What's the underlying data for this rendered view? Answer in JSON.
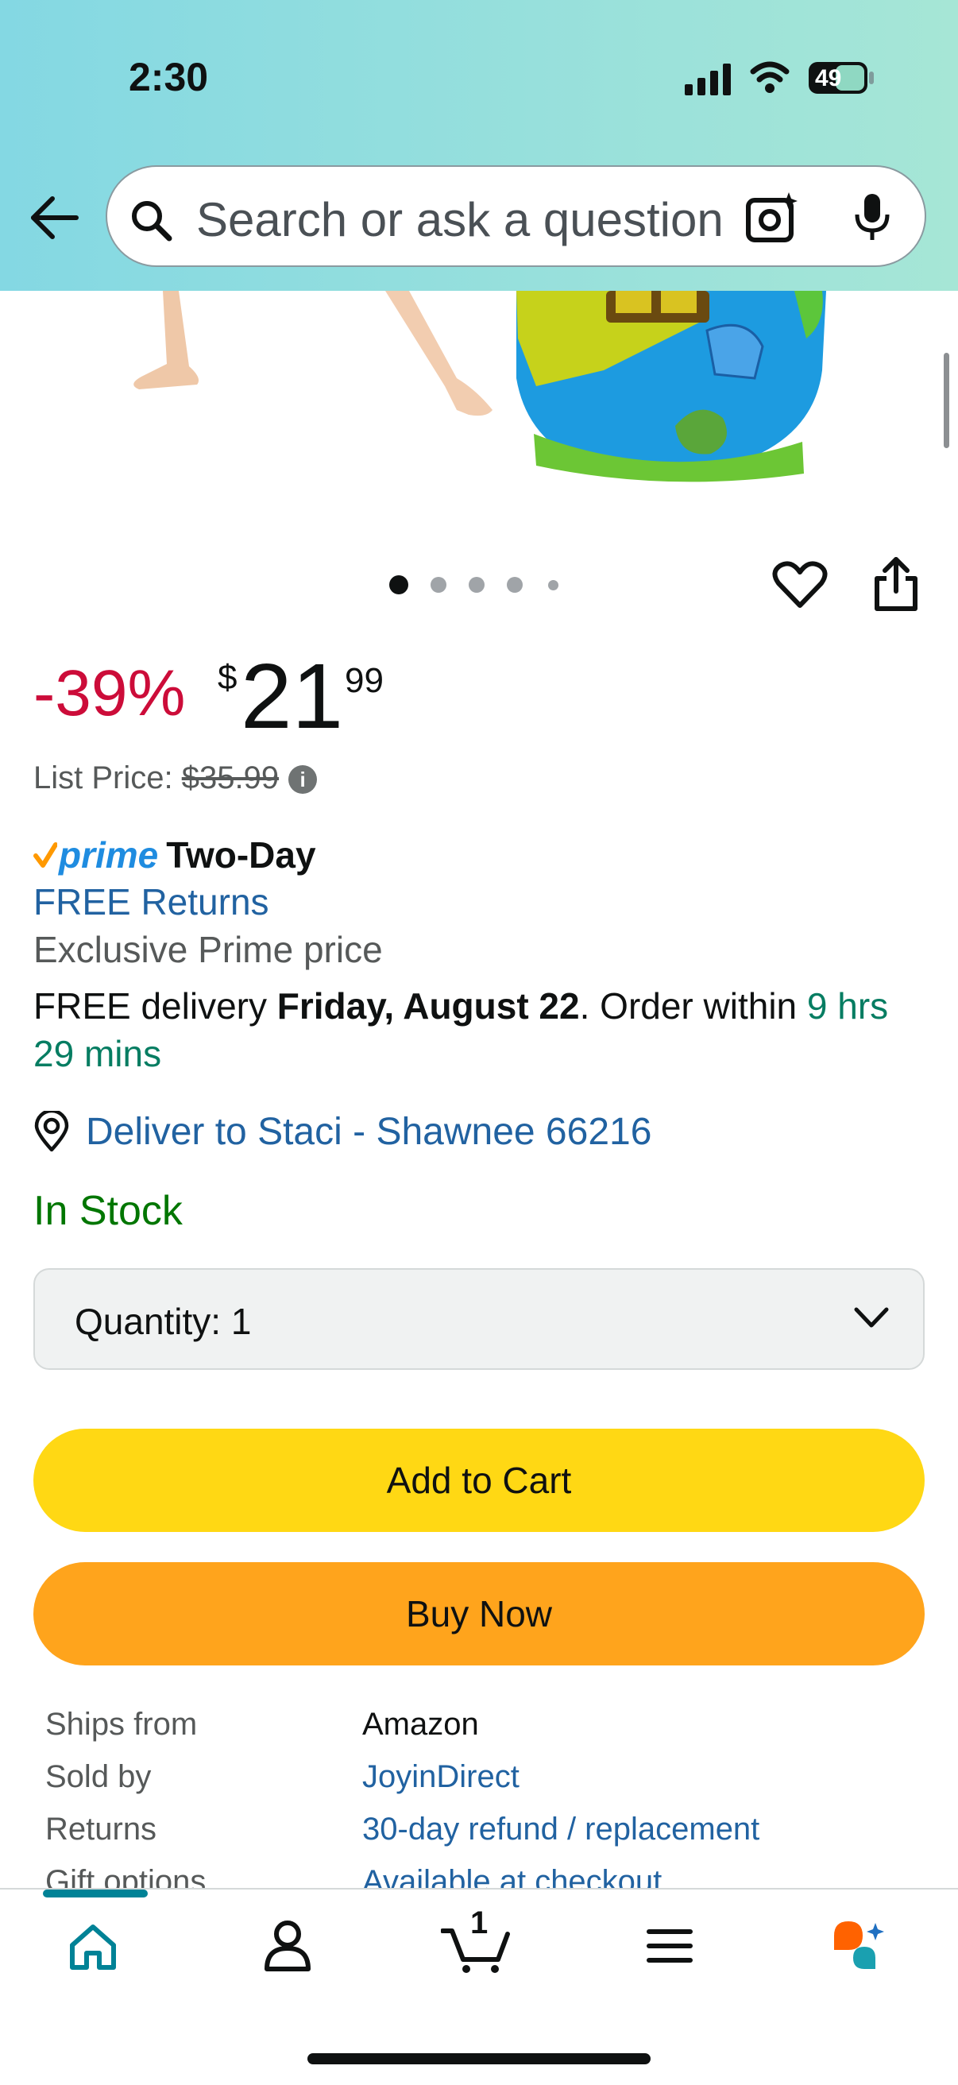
{
  "status_bar": {
    "time": "2:30",
    "battery": "49"
  },
  "search": {
    "placeholder": "Search or ask a question"
  },
  "image_carousel": {
    "page_count": 5,
    "current_index": 0
  },
  "price": {
    "discount": "-39%",
    "currency_symbol": "$",
    "dollars": "21",
    "cents": "99",
    "list_price_label": "List Price:",
    "list_price_value": "$35.99"
  },
  "prime": {
    "logo_text": "prime",
    "shipping": "Two-Day",
    "free_returns": "FREE Returns",
    "exclusive": "Exclusive Prime price"
  },
  "delivery": {
    "prefix": "FREE delivery ",
    "date": "Friday, August 22",
    "middle": ". Order within ",
    "countdown": "9 hrs 29 mins"
  },
  "deliver_to": "Deliver to Staci - Shawnee 66216",
  "stock": "In Stock",
  "quantity": {
    "label": "Quantity:",
    "value": "1"
  },
  "buttons": {
    "add_to_cart": "Add to Cart",
    "buy_now": "Buy Now"
  },
  "details": {
    "rows": [
      {
        "label": "Ships from",
        "value": "Amazon"
      },
      {
        "label": "Sold by",
        "value": "JoyinDirect"
      },
      {
        "label": "Returns",
        "value": "30-day refund / replacement"
      },
      {
        "label": "Gift options",
        "value": "Available at checkout"
      }
    ]
  },
  "bottom_nav": {
    "cart_count": "1",
    "items": [
      "home-icon",
      "account-icon",
      "cart-icon",
      "menu-icon",
      "rufus-ai-icon"
    ]
  },
  "colors": {
    "accent_teal": "#008296",
    "discount_red": "#cc0c39",
    "link_blue": "#2162a1",
    "stock_green": "#007600",
    "countdown_green": "#067d62",
    "add_to_cart_yellow": "#ffd814",
    "buy_now_orange": "#ffa41c",
    "prime_blue": "#1f8ce0"
  }
}
